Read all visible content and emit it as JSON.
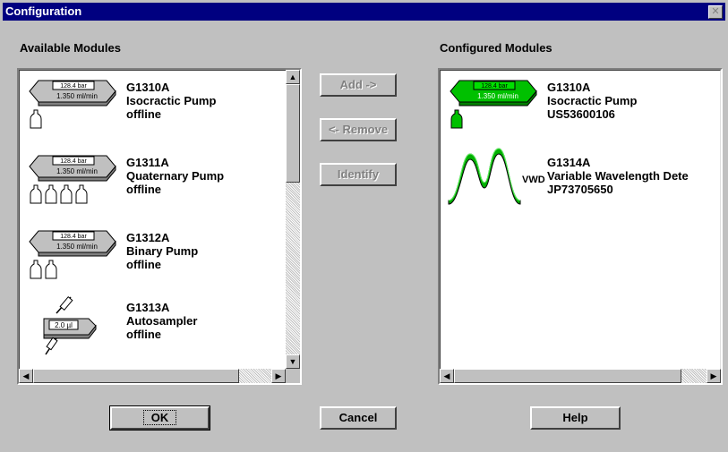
{
  "window": {
    "title": "Configuration",
    "close_glyph": "✕"
  },
  "available": {
    "header": "Available Modules",
    "items": [
      {
        "icon": "isocratic-pump-icon",
        "model": "G1310A",
        "name": "Isocractic Pump",
        "status": "offline",
        "pump_label": [
          "128.4 bar",
          "1.350 ml/min"
        ]
      },
      {
        "icon": "quaternary-pump-icon",
        "model": "G1311A",
        "name": "Quaternary Pump",
        "status": "offline",
        "pump_label": [
          "128.4 bar",
          "1.350 ml/min"
        ]
      },
      {
        "icon": "binary-pump-icon",
        "model": "G1312A",
        "name": "Binary Pump",
        "status": "offline",
        "pump_label": [
          "128.4 bar",
          "1.350 ml/min"
        ]
      },
      {
        "icon": "autosampler-icon",
        "model": "G1313A",
        "name": "Autosampler",
        "status": "offline",
        "sampler_label": "2.0 µl"
      }
    ]
  },
  "configured": {
    "header": "Configured Modules",
    "items": [
      {
        "icon": "isocratic-pump-icon",
        "model": "G1310A",
        "name": "Isocractic Pump",
        "serial": "US53600106",
        "pump_label": [
          "128.4 bar",
          "1.350 ml/min"
        ]
      },
      {
        "icon": "vwd-detector-icon",
        "model": "G1314A",
        "name": "Variable Wavelength Dete",
        "serial": "JP73705650",
        "icon_label": "VWD"
      }
    ]
  },
  "buttons": {
    "add": "Add ->",
    "remove": "<- Remove",
    "identify": "Identify",
    "ok": "OK",
    "cancel": "Cancel",
    "help": "Help"
  },
  "colors": {
    "title_bar": "#000080",
    "configured_accent": "#00c000",
    "face": "#c0c0c0"
  }
}
